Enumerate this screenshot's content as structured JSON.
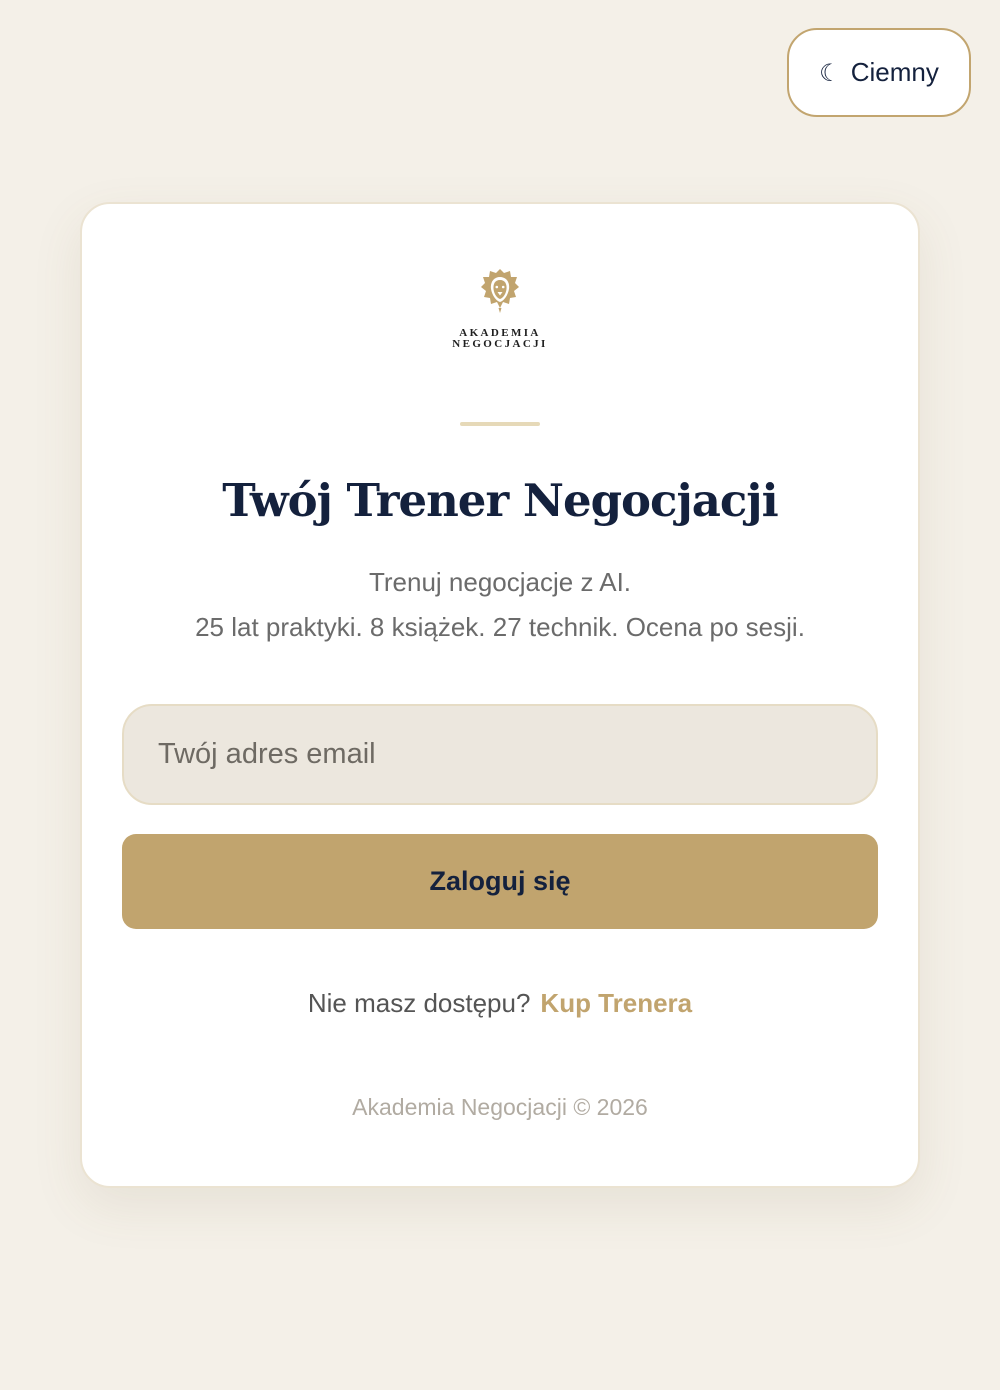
{
  "theme_toggle": {
    "icon": "moon-icon",
    "label": "Ciemny"
  },
  "logo": {
    "icon": "lion-icon",
    "line1": "AKADEMIA",
    "line2": "NEGOCJACJI"
  },
  "heading": {
    "title": "Twój Trener Negocjacji",
    "subtitle_line1": "Trenuj negocjacje z AI.",
    "subtitle_line2": "25 lat praktyki. 8 książek. 27 technik. Ocena po sesji."
  },
  "form": {
    "email_placeholder": "Twój adres email",
    "email_value": "",
    "submit_label": "Zaloguj się"
  },
  "access": {
    "question": "Nie masz dostępu?",
    "link_label": "Kup Trenera"
  },
  "footer": {
    "text": "Akademia Negocjacji © 2026"
  },
  "colors": {
    "background": "#f4f0e8",
    "gold": "#c1a46e",
    "navy": "#14213d",
    "card": "#ffffff",
    "input_bg": "#ece7de"
  }
}
